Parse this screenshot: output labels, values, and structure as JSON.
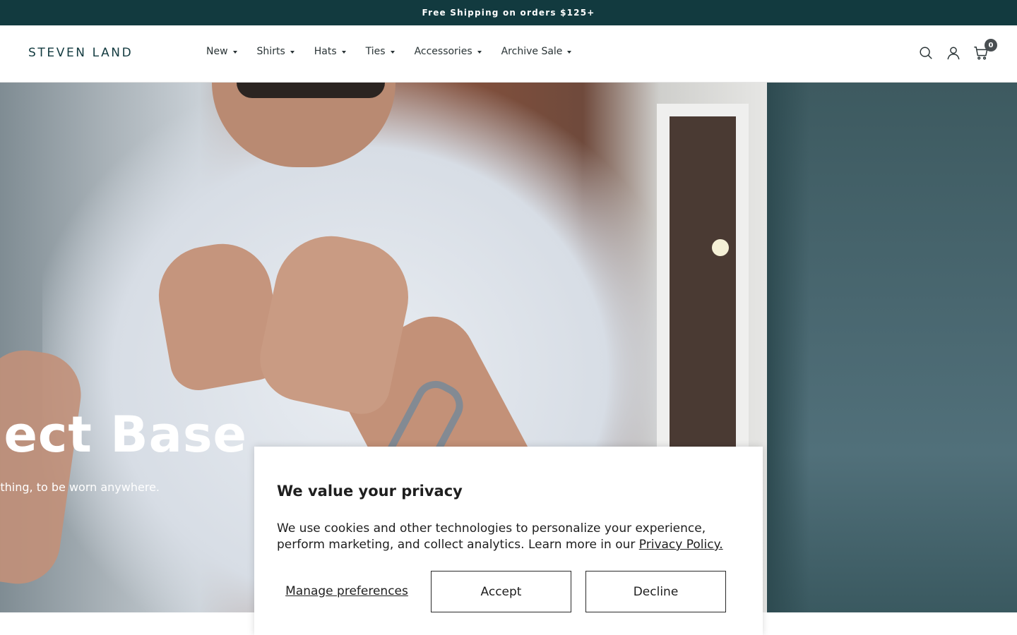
{
  "announcement": {
    "text": "Free Shipping on orders $125+"
  },
  "header": {
    "logo": "STEVEN LAND",
    "nav": [
      {
        "label": "New"
      },
      {
        "label": "Shirts"
      },
      {
        "label": "Hats"
      },
      {
        "label": "Ties"
      },
      {
        "label": "Accessories"
      },
      {
        "label": "Archive Sale"
      }
    ],
    "icons": [
      "search-icon",
      "account-icon",
      "cart-icon"
    ],
    "cart_count": "0"
  },
  "hero": {
    "title": "ect Base",
    "subtitle": "nything, to be worn anywhere."
  },
  "privacy": {
    "title": "We value your privacy",
    "text": "We use cookies and other technologies to personalize your experience, perform marketing, and collect analytics. Learn more in our ",
    "link": "Privacy Policy.",
    "manage_label": "Manage preferences",
    "accept_label": "Accept",
    "decline_label": "Decline"
  },
  "colors": {
    "announcement_bg": "#123a3f",
    "logo": "#123a3f",
    "hero_side": "#4a6871"
  }
}
